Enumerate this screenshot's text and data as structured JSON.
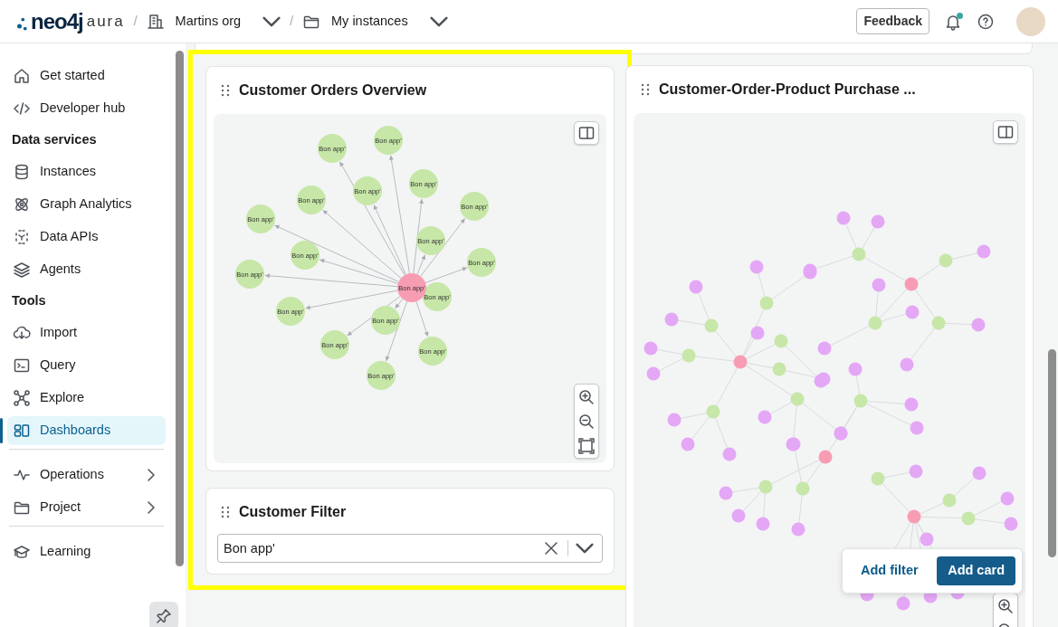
{
  "header": {
    "logo": "neo4j",
    "logo_suffix": "aura",
    "separator": "/",
    "breadcrumbs": [
      {
        "label": "Martins org",
        "kind": "org"
      },
      {
        "label": "My instances",
        "kind": "folder"
      }
    ],
    "feedback": "Feedback",
    "has_notification": true
  },
  "sidebar": {
    "items": [
      {
        "kind": "link",
        "label": "Get started",
        "selected": false
      },
      {
        "kind": "link",
        "label": "Developer hub",
        "selected": false
      },
      {
        "kind": "heading",
        "label": "Data services"
      },
      {
        "kind": "link",
        "label": "Instances",
        "selected": false
      },
      {
        "kind": "link",
        "label": "Graph Analytics",
        "selected": false
      },
      {
        "kind": "link",
        "label": "Data APIs",
        "selected": false
      },
      {
        "kind": "link",
        "label": "Agents",
        "selected": false
      },
      {
        "kind": "heading",
        "label": "Tools"
      },
      {
        "kind": "link",
        "label": "Import",
        "selected": false
      },
      {
        "kind": "link",
        "label": "Query",
        "selected": false
      },
      {
        "kind": "link",
        "label": "Explore",
        "selected": false
      },
      {
        "kind": "link",
        "label": "Dashboards",
        "selected": true
      },
      {
        "kind": "divider"
      },
      {
        "kind": "link",
        "label": "Operations",
        "selected": false,
        "expandable": true
      },
      {
        "kind": "link",
        "label": "Project",
        "selected": false,
        "expandable": true
      },
      {
        "kind": "divider"
      },
      {
        "kind": "link",
        "label": "Learning",
        "selected": false
      }
    ]
  },
  "cards": [
    {
      "kind": "graph",
      "title": "Customer Orders Overview",
      "graph": {
        "center": "Bon app'",
        "leaves": [
          {
            "label": "Bon app'"
          },
          {
            "label": "Bon app'"
          },
          {
            "label": "Bon app'"
          },
          {
            "label": "Bon app'"
          },
          {
            "label": "Bon app'"
          },
          {
            "label": "Bon app'"
          },
          {
            "label": "Bon app'"
          },
          {
            "label": "Bon app'"
          },
          {
            "label": "Bon app'"
          },
          {
            "label": "Bon app'"
          },
          {
            "label": "Bon app'"
          },
          {
            "label": "Bon app'"
          },
          {
            "label": "Bon app'"
          },
          {
            "label": "Bon app'"
          },
          {
            "label": "Bon app'"
          },
          {
            "label": "Bon app'"
          },
          {
            "label": "Bon app'"
          }
        ]
      }
    },
    {
      "kind": "filter",
      "title": "Customer Filter",
      "value": "Bon app'"
    },
    {
      "kind": "graph-picture",
      "title": "Customer-Order-Product Purchase ..."
    }
  ],
  "actions": {
    "add_filter": "Add filter",
    "add_card": "Add card"
  }
}
